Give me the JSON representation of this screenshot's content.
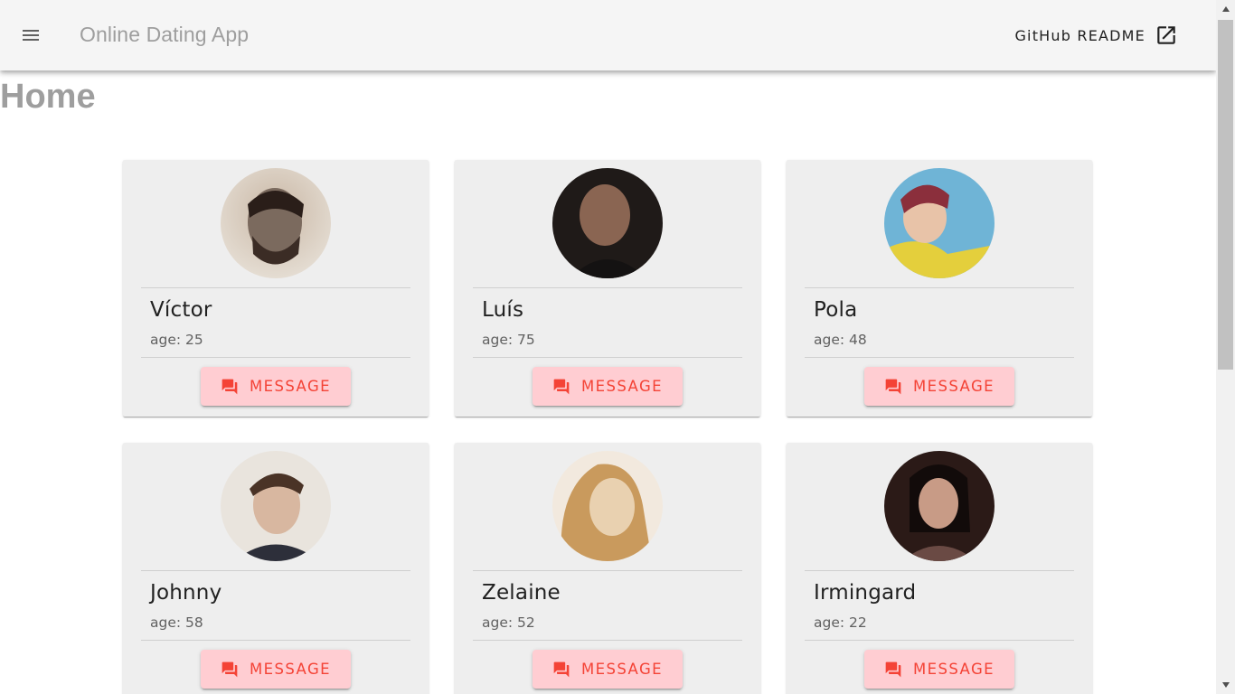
{
  "app": {
    "title": "Online Dating App",
    "readme_label": "GitHub README",
    "page_title": "Home"
  },
  "profiles": [
    {
      "name": "Víctor",
      "age": "age: 25",
      "button": "MESSAGE",
      "avatar_colors": [
        "#7b6a5e",
        "#3b2c25",
        "#c9b7a5"
      ]
    },
    {
      "name": "Luís",
      "age": "age: 75",
      "button": "MESSAGE",
      "avatar_colors": [
        "#6d4f3f",
        "#1f1a18",
        "#a88671"
      ]
    },
    {
      "name": "Pola",
      "age": "age: 48",
      "button": "MESSAGE",
      "avatar_colors": [
        "#e8c3a8",
        "#6fb4d6",
        "#e4cf3c"
      ]
    },
    {
      "name": "Johnny",
      "age": "age: 58",
      "button": "MESSAGE",
      "avatar_colors": [
        "#d8b7a0",
        "#4a3326",
        "#e9e4dd"
      ]
    },
    {
      "name": "Zelaine",
      "age": "age: 52",
      "button": "MESSAGE",
      "avatar_colors": [
        "#e9d1b0",
        "#c99a5d",
        "#f2e9de"
      ]
    },
    {
      "name": "Irmingard",
      "age": "age: 22",
      "button": "MESSAGE",
      "avatar_colors": [
        "#2b1a17",
        "#c89b86",
        "#6a4a44"
      ]
    }
  ],
  "colors": {
    "appbar_bg": "#f5f5f5",
    "card_bg": "#eeeeee",
    "button_bg": "#ffcdd2",
    "button_text": "#f44336",
    "title_gray": "#9e9e9e"
  },
  "icons": {
    "menu": "menu-icon",
    "open_in_new": "open-in-new-icon",
    "message": "chat-bubbles-icon"
  }
}
